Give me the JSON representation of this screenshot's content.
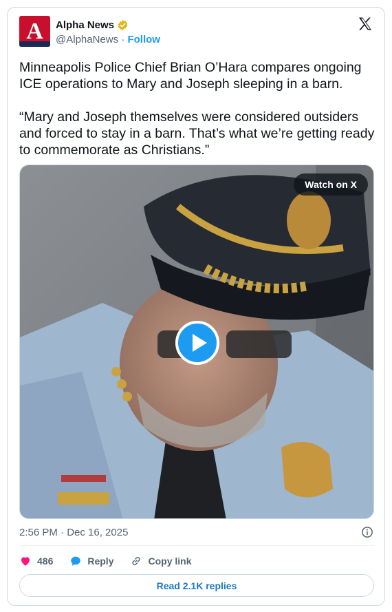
{
  "author": {
    "name": "Alpha News",
    "handle": "@AlphaNews",
    "separator": "·",
    "follow_label": "Follow",
    "avatar_letter": "A"
  },
  "tweet": {
    "paragraphs": [
      "Minneapolis Police Chief Brian O’Hara compares ongoing ICE operations to Mary and Joseph sleeping in a barn.",
      "“Mary and Joseph themselves were considered outsiders and forced to stay in a barn. That’s what we’re getting ready to commemorate as Christians.”"
    ]
  },
  "media": {
    "watch_label": "Watch on X"
  },
  "timestamp": "2:56 PM · Dec 16, 2025",
  "actions": {
    "like_count": "486",
    "reply_label": "Reply",
    "copy_label": "Copy link"
  },
  "read_replies_label": "Read 2.1K replies",
  "colors": {
    "brand_red": "#c8102e",
    "link_blue": "#1d9bf0",
    "like_pink": "#f91880",
    "verified_gold": "#e2b719"
  },
  "icons": [
    "verified-badge-icon",
    "x-logo-icon",
    "play-icon",
    "info-icon",
    "heart-icon",
    "reply-icon",
    "link-icon"
  ]
}
